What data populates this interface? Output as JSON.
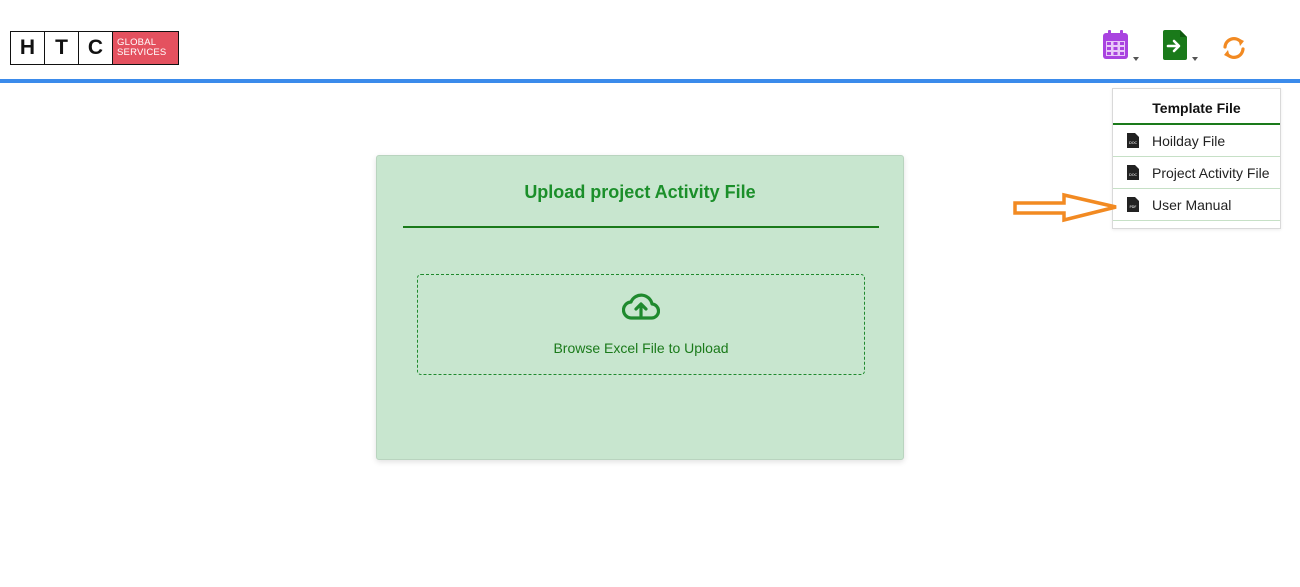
{
  "header": {
    "logo_letters": [
      "H",
      "T",
      "C"
    ],
    "logo_brand_line1": "GLOBAL",
    "logo_brand_line2": "SERVICES",
    "icons": [
      {
        "name": "calendar-icon",
        "color": "#a943e0"
      },
      {
        "name": "file-export-icon",
        "color": "#1a7a1a"
      },
      {
        "name": "refresh-icon",
        "color": "#f28a22"
      }
    ],
    "accent_bar_color": "#3b8beb"
  },
  "template_menu": {
    "title": "Template File",
    "items": [
      {
        "label": "Hoilday File",
        "icon": "doc-file-icon"
      },
      {
        "label": "Project Activity File",
        "icon": "doc-file-icon"
      },
      {
        "label": "User Manual",
        "icon": "pdf-file-icon"
      }
    ]
  },
  "upload_card": {
    "title": "Upload project Activity File",
    "dropzone_label": "Browse Excel File to Upload",
    "icon": "cloud-upload-icon",
    "accent_color": "#1b8f2a",
    "background_color": "#c8e6cf"
  },
  "annotation": {
    "icon": "arrow-right-icon",
    "color": "#f28a22"
  }
}
